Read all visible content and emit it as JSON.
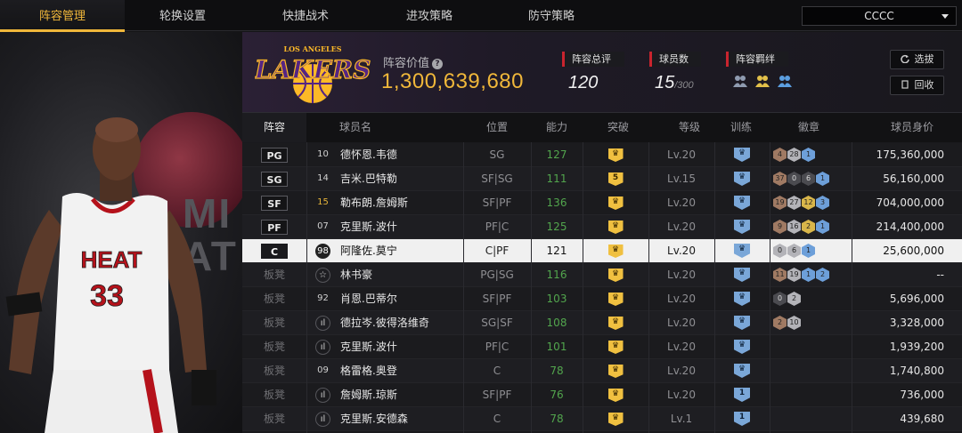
{
  "nav": {
    "tabs": [
      "阵容管理",
      "轮换设置",
      "快捷战术",
      "进攻策略",
      "防守策略"
    ],
    "active_tab": 0,
    "team_select": "CCCC"
  },
  "portrait": {
    "jersey_team": "HEAT",
    "jersey_number": "33",
    "background_text": "MI\nAT"
  },
  "header": {
    "logo_text": "LAKERS",
    "logo_small": "LOS ANGELES",
    "value_label": "阵容价值",
    "value": "1,300,639,680",
    "rating_label": "阵容总评",
    "rating": "120",
    "players_label": "球员数",
    "players_count": "15",
    "players_max": "/300",
    "bond_label": "阵容羁绊",
    "select_button": "选拔",
    "recycle_button": "回收"
  },
  "table": {
    "headers": [
      "阵容",
      "球员名",
      "位置",
      "能力",
      "突破",
      "等级",
      "训练",
      "徽章",
      "球员身价"
    ],
    "rows": [
      {
        "slot": "PG",
        "num": "10",
        "num_style": "plain",
        "name": "德怀恩.韦德",
        "pos": "SG",
        "ability": "127",
        "breakthrough": "",
        "level": "Lv.20",
        "train": "",
        "badges": [
          [
            "bronze",
            "4"
          ],
          [
            "silver",
            "28"
          ],
          [
            "blue",
            "1"
          ]
        ],
        "value": "175,360,000"
      },
      {
        "slot": "SG",
        "num": "14",
        "num_style": "plain",
        "name": "吉米.巴特勒",
        "pos": "SF|SG",
        "ability": "111",
        "breakthrough": "5",
        "level": "Lv.15",
        "train": "",
        "badges": [
          [
            "bronze",
            "37"
          ],
          [
            "dark",
            "0"
          ],
          [
            "dark",
            "6"
          ],
          [
            "blue",
            "1"
          ]
        ],
        "value": "56,160,000"
      },
      {
        "slot": "SF",
        "num": "15",
        "num_style": "gold",
        "name": "勒布朗.詹姆斯",
        "pos": "SF|PF",
        "ability": "136",
        "breakthrough": "",
        "level": "Lv.20",
        "train": "",
        "badges": [
          [
            "bronze",
            "19"
          ],
          [
            "silver",
            "27"
          ],
          [
            "gold",
            "12"
          ],
          [
            "blue",
            "3"
          ]
        ],
        "value": "704,000,000"
      },
      {
        "slot": "PF",
        "num": "07",
        "num_style": "plain",
        "name": "克里斯.波什",
        "pos": "PF|C",
        "ability": "125",
        "breakthrough": "",
        "level": "Lv.20",
        "train": "",
        "badges": [
          [
            "bronze",
            "9"
          ],
          [
            "silver",
            "16"
          ],
          [
            "gold",
            "2"
          ],
          [
            "blue",
            "1"
          ]
        ],
        "value": "214,400,000"
      },
      {
        "slot": "C",
        "num": "98",
        "num_style": "circle",
        "name": "阿隆佐.莫宁",
        "pos": "C|PF",
        "ability": "121",
        "breakthrough": "",
        "level": "Lv.20",
        "train": "",
        "badges": [
          [
            "silver",
            "0"
          ],
          [
            "silver",
            "6"
          ],
          [
            "blue",
            "1"
          ]
        ],
        "value": "25,600,000"
      },
      {
        "slot": "板凳",
        "num": "☆",
        "num_style": "circle",
        "name": "林书豪",
        "pos": "PG|SG",
        "ability": "116",
        "breakthrough": "",
        "level": "Lv.20",
        "train": "",
        "badges": [
          [
            "bronze",
            "11"
          ],
          [
            "silver",
            "19"
          ],
          [
            "blue",
            "1"
          ],
          [
            "blue",
            "2"
          ]
        ],
        "value": "--"
      },
      {
        "slot": "板凳",
        "num": "92",
        "num_style": "plain",
        "name": "肖恩.巴蒂尔",
        "pos": "SF|PF",
        "ability": "103",
        "breakthrough": "",
        "level": "Lv.20",
        "train": "",
        "badges": [
          [
            "dark",
            "0"
          ],
          [
            "silver",
            "2"
          ]
        ],
        "value": "5,696,000"
      },
      {
        "slot": "板凳",
        "num": "ıl",
        "num_style": "circle",
        "name": "德拉岑.彼得洛维奇",
        "pos": "SG|SF",
        "ability": "108",
        "breakthrough": "",
        "level": "Lv.20",
        "train": "",
        "badges": [
          [
            "bronze",
            "2"
          ],
          [
            "silver",
            "10"
          ]
        ],
        "value": "3,328,000"
      },
      {
        "slot": "板凳",
        "num": "ıl",
        "num_style": "circle",
        "name": "克里斯.波什",
        "pos": "PF|C",
        "ability": "101",
        "breakthrough": "",
        "level": "Lv.20",
        "train": "",
        "badges": [],
        "value": "1,939,200"
      },
      {
        "slot": "板凳",
        "num": "09",
        "num_style": "plain",
        "name": "格雷格.奥登",
        "pos": "C",
        "ability": "78",
        "breakthrough": "",
        "level": "Lv.20",
        "train": "",
        "badges": [],
        "value": "1,740,800"
      },
      {
        "slot": "板凳",
        "num": "ıl",
        "num_style": "circle",
        "name": "詹姆斯.琼斯",
        "pos": "SF|PF",
        "ability": "76",
        "breakthrough": "",
        "level": "Lv.20",
        "train": "1",
        "badges": [],
        "value": "736,000"
      },
      {
        "slot": "板凳",
        "num": "ıl",
        "num_style": "circle",
        "name": "克里斯.安德森",
        "pos": "C",
        "ability": "78",
        "breakthrough": "",
        "level": "Lv.1",
        "train": "1",
        "badges": [],
        "value": "439,680"
      }
    ],
    "selected_row": 4
  },
  "colors": {
    "accent": "#f0b73a",
    "ability_green": "#52a54d",
    "header_mark": "#c9242e",
    "lakers_purple": "#552583",
    "lakers_gold": "#fdb927"
  }
}
